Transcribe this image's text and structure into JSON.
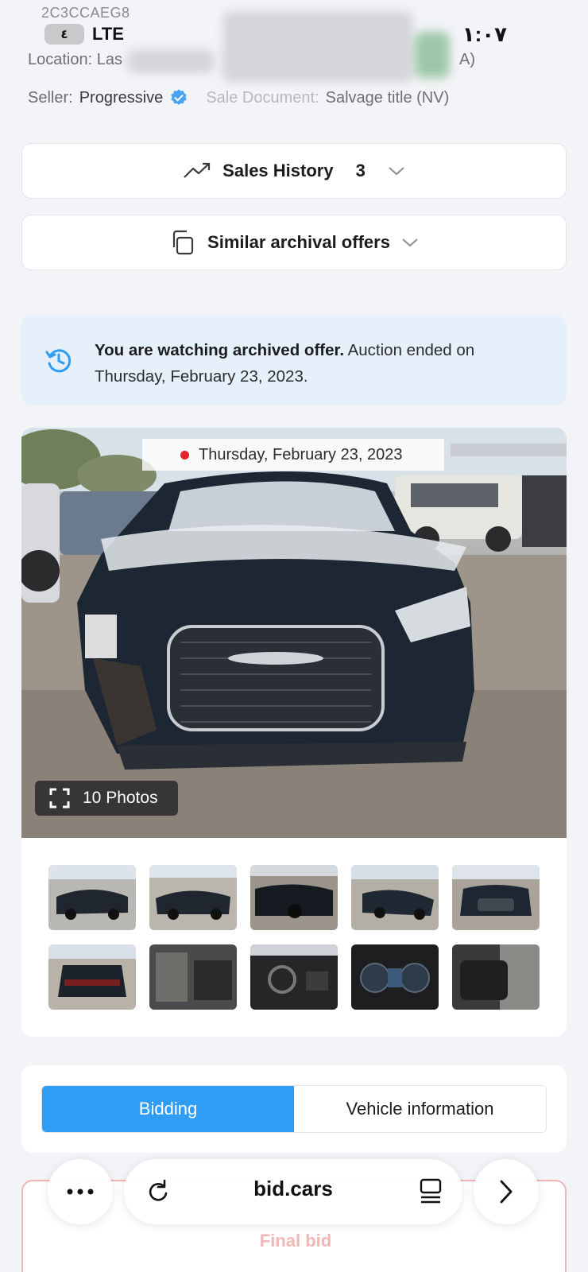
{
  "status_bar": {
    "network": "LTE",
    "battery": "٤",
    "time": "١:٠٧"
  },
  "header": {
    "vin_partial": "2C3CCAEG8",
    "location_prefix": "Location: Las",
    "location_suffix": "A)",
    "seller_label": "Seller:",
    "seller_name": "Progressive",
    "sale_document_label": "Sale Document:",
    "sale_document_value": "Salvage title (NV)"
  },
  "accordions": {
    "sales_history": {
      "label": "Sales History",
      "count": "3"
    },
    "similar_offers": {
      "label": "Similar archival offers"
    }
  },
  "notice": {
    "bold": "You are watching archived offer.",
    "rest": " Auction ended on Thursday, February 23, 2023."
  },
  "gallery": {
    "date_label": "Thursday, February 23, 2023",
    "photos_button": "10 Photos"
  },
  "tabs": {
    "bidding": "Bidding",
    "vehicle_information": "Vehicle information"
  },
  "final_bid": {
    "label": "Final bid"
  },
  "browser": {
    "url": "bid.cars"
  },
  "colors": {
    "accent_blue": "#2f9df4",
    "notice_bg": "#e5f0fb",
    "live_dot": "#e0262a",
    "final_bid_border": "#f1b4b4"
  },
  "icons": [
    "trending-up-icon",
    "chevron-down-icon",
    "copy-icon",
    "history-icon",
    "expand-icon",
    "verified-badge-icon",
    "more-icon",
    "reload-icon",
    "tabs-icon",
    "chevron-right-icon"
  ]
}
